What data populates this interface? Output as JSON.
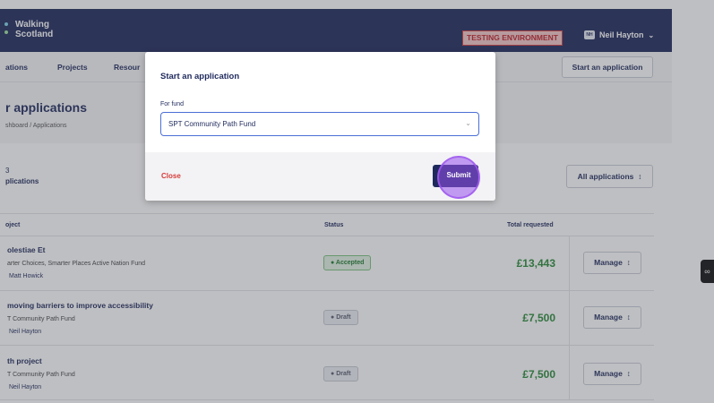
{
  "header": {
    "logo_line1": "Walking",
    "logo_line2": "Scotland",
    "environment_badge": "TESTING ENVIRONMENT",
    "user_initials": "NH",
    "user_name": "Neil Hayton"
  },
  "nav": {
    "items": [
      "ations",
      "Projects",
      "Resour"
    ],
    "start_button": "Start an application"
  },
  "page": {
    "title": "r applications",
    "breadcrumb": "shboard / Applications"
  },
  "summary": {
    "count": "3",
    "label": "plications",
    "filter_button": "All applications"
  },
  "table": {
    "headers": [
      "oject",
      "Status",
      "Total requested"
    ],
    "rows": [
      {
        "title": "olestiae Et",
        "fund": "arter Choices, Smarter Places Active Nation Fund",
        "owner": "Matt Howick",
        "status": "Accepted",
        "status_type": "accepted",
        "amount": "£13,443",
        "action": "Manage"
      },
      {
        "title": "moving barriers to improve accessibility",
        "fund": "T Community Path Fund",
        "owner": "Neil Hayton",
        "status": "Draft",
        "status_type": "draft",
        "amount": "£7,500",
        "action": "Manage"
      },
      {
        "title": "th project",
        "fund": "T Community Path Fund",
        "owner": "Neil Hayton",
        "status": "Draft",
        "status_type": "draft",
        "amount": "£7,500",
        "action": "Manage"
      }
    ]
  },
  "modal": {
    "title": "Start an application",
    "field_label": "For fund",
    "selected_fund": "SPT Community Path Fund",
    "close_label": "Close",
    "submit_label": "Submit"
  },
  "colors": {
    "brand_navy": "#1f2a5c",
    "accepted_green": "#2a8a3a",
    "danger_red": "#d63b3b",
    "click_highlight": "#9650eb"
  },
  "icons": {
    "user_menu": "chevron-down-icon",
    "filter": "sort-arrows-icon",
    "manage": "sort-arrows-icon",
    "select": "chevron-down-icon"
  }
}
